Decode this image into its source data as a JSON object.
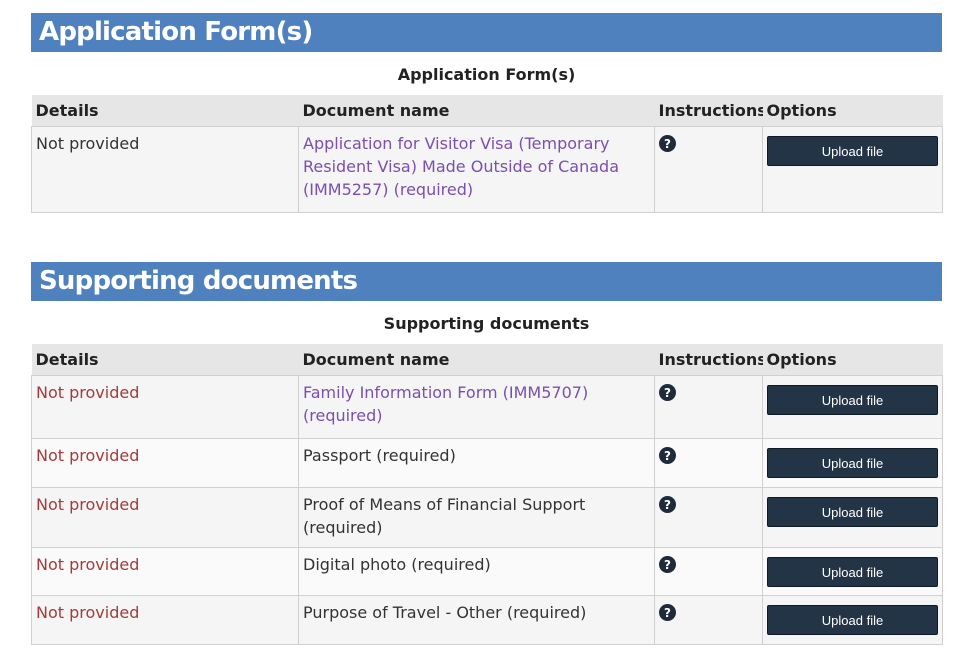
{
  "sections": [
    {
      "title": "Application Form(s)",
      "caption": "Application Form(s)",
      "headers": [
        "Details",
        "Document name",
        "Instructions",
        "Options"
      ],
      "rows": [
        {
          "status": "Not provided",
          "status_type": "neutral",
          "doc_name": "Application for Visitor Visa (Temporary Resident Visa) Made Outside of Canada (IMM5257)  (required)",
          "doc_is_link": true,
          "button": "Upload file"
        }
      ]
    },
    {
      "title": "Supporting documents",
      "caption": "Supporting documents",
      "headers": [
        "Details",
        "Document name",
        "Instructions",
        "Options"
      ],
      "rows": [
        {
          "status": "Not provided",
          "status_type": "missing",
          "doc_name": "Family Information Form (IMM5707)  (required)",
          "doc_is_link": true,
          "button": "Upload file"
        },
        {
          "status": "Not provided",
          "status_type": "missing",
          "doc_name": "Passport  (required)",
          "doc_is_link": false,
          "button": "Upload file"
        },
        {
          "status": "Not provided",
          "status_type": "missing",
          "doc_name": "Proof of Means of Financial Support  (required)",
          "doc_is_link": false,
          "button": "Upload file"
        },
        {
          "status": "Not provided",
          "status_type": "missing",
          "doc_name": "Digital photo  (required)",
          "doc_is_link": false,
          "button": "Upload file"
        },
        {
          "status": "Not provided",
          "status_type": "missing",
          "doc_name": "Purpose of Travel - Other  (required)",
          "doc_is_link": false,
          "button": "Upload file"
        }
      ]
    }
  ],
  "colors": {
    "header_bg": "#4f81bf",
    "link": "#7a4fb0",
    "missing": "#a63a3a",
    "button_bg": "#243447"
  },
  "icons": {
    "instructions": "question-circle-icon"
  }
}
